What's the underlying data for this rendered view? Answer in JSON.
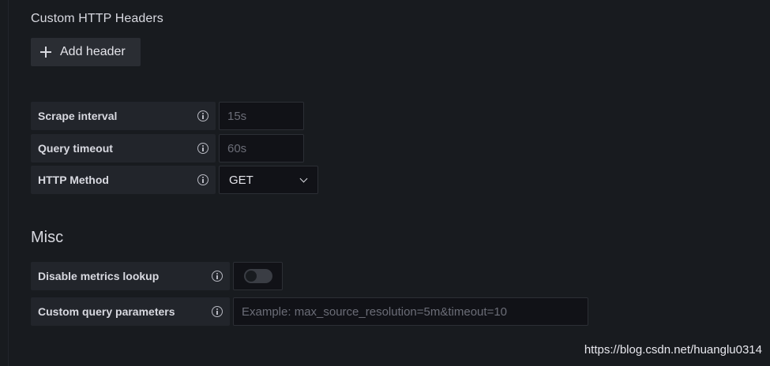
{
  "headers": {
    "title": "Custom HTTP Headers",
    "add_label": "Add header"
  },
  "fields": {
    "scrape_interval": {
      "label": "Scrape interval",
      "placeholder": "15s"
    },
    "query_timeout": {
      "label": "Query timeout",
      "placeholder": "60s"
    },
    "http_method": {
      "label": "HTTP Method",
      "value": "GET"
    }
  },
  "misc": {
    "title": "Misc",
    "disable_metrics": {
      "label": "Disable metrics lookup",
      "enabled": false
    },
    "custom_query": {
      "label": "Custom query parameters",
      "placeholder": "Example: max_source_resolution=5m&timeout=10"
    }
  },
  "watermark": "https://blog.csdn.net/huanglu0314"
}
